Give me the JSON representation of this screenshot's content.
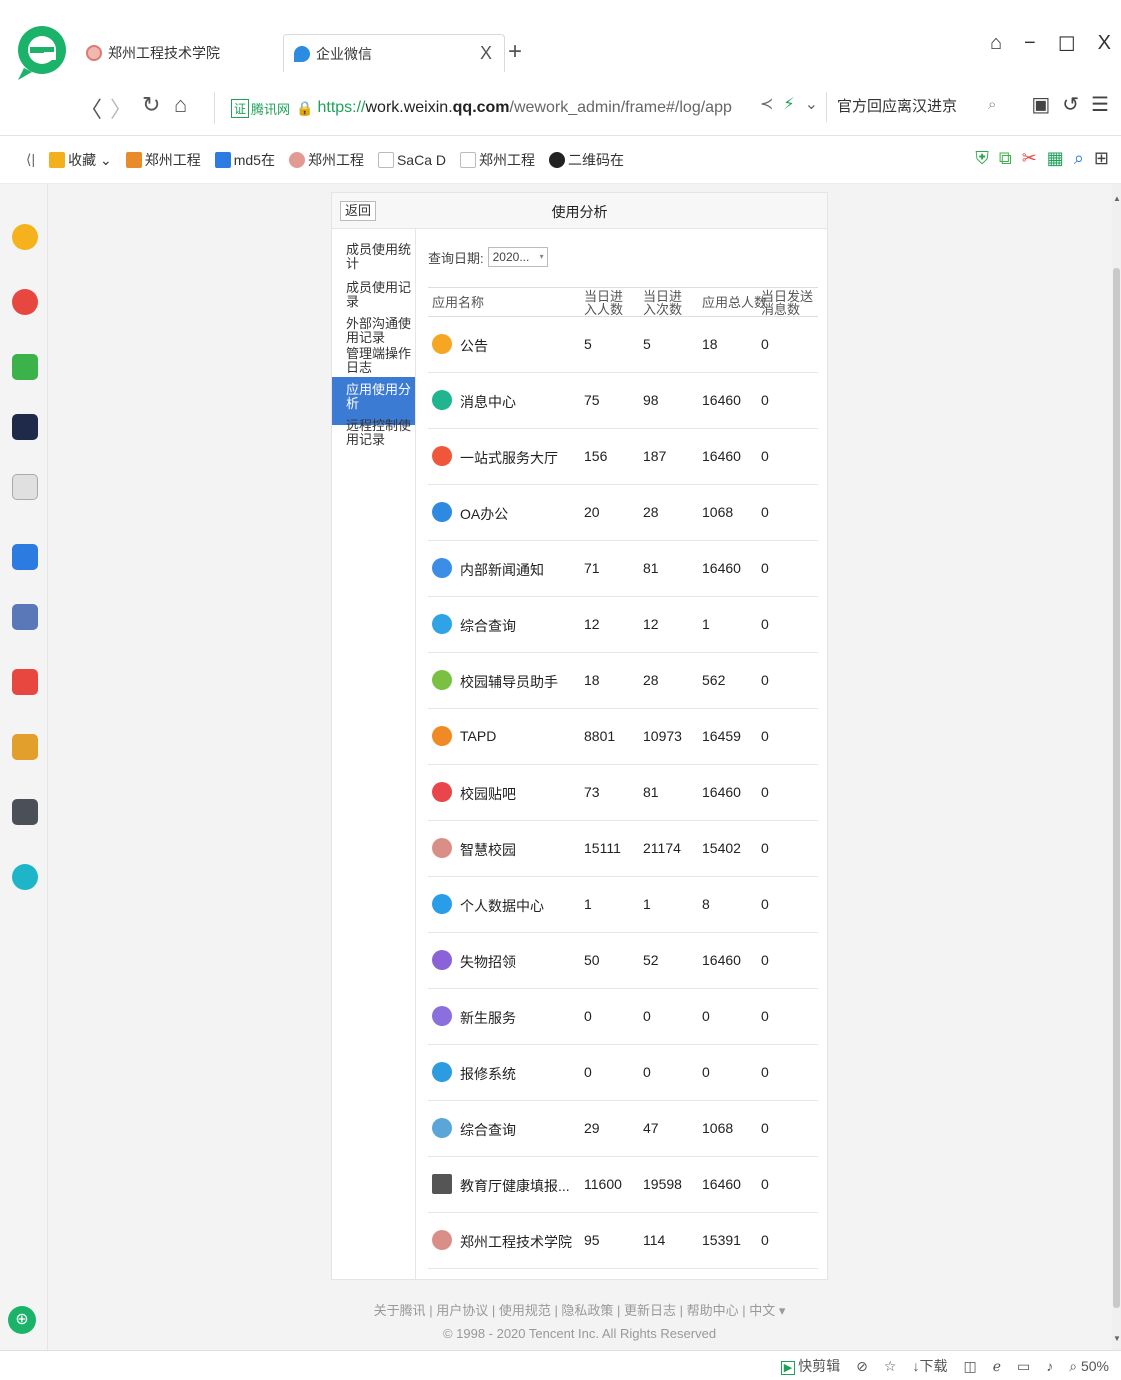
{
  "browser": {
    "tabs": [
      {
        "label": "郑州工程技术学院",
        "icon": "college-seal-icon"
      },
      {
        "label": "企业微信",
        "icon": "wework-icon",
        "active": true
      }
    ],
    "new_tab": "+",
    "tab_close": "X",
    "window_controls": {
      "skin": "skin-icon",
      "minimize": "−",
      "maximize": "☐",
      "close": "X"
    }
  },
  "addressbar": {
    "cert_badge": "证",
    "cert_label": "腾讯网",
    "url_scheme": "https://",
    "url_host_prefix": "work.weixin.",
    "url_host_bold": "qq.com",
    "url_path": "/wework_admin/frame#/log/app",
    "search_text": "官方回应离汉进京"
  },
  "bookmarks": {
    "toggle": "⟨|",
    "items": [
      {
        "label": "收藏 ⌄",
        "icon": "star-folder-icon",
        "color": "#f2b01e"
      },
      {
        "label": "郑州工程",
        "icon": "college-icon",
        "color": "#e98a2b"
      },
      {
        "label": "md5在",
        "icon": "md5-icon",
        "color": "#2b7be0"
      },
      {
        "label": "郑州工程",
        "icon": "seal-icon",
        "color": "#e29a93"
      },
      {
        "label": "SaCa D",
        "icon": "page-icon",
        "color": "#bbbbbb"
      },
      {
        "label": "郑州工程",
        "icon": "page-icon",
        "color": "#bbbbbb"
      },
      {
        "label": "二维码在",
        "icon": "qr-icon",
        "color": "#222222"
      }
    ]
  },
  "panel": {
    "back_label": "返回",
    "title": "使用分析",
    "menu": [
      {
        "label": "成员使用统计",
        "active": false
      },
      {
        "label": "成员使用记录",
        "active": false
      },
      {
        "label": "外部沟通使用记录",
        "active": false
      },
      {
        "label": "管理端操作日志",
        "active": false
      },
      {
        "label": "应用使用分析",
        "active": true
      },
      {
        "label": "远程控制使用记录",
        "active": false
      }
    ],
    "query_label": "查询日期:",
    "query_value": "2020...",
    "columns": [
      "应用名称",
      "当日进入人数",
      "当日进入次数",
      "应用总人数",
      "当日发送消息数"
    ],
    "rows": [
      {
        "name": "公告",
        "icon": "announcement-icon",
        "color": "#f5a623",
        "a": "5",
        "b": "5",
        "c": "18",
        "d": "0"
      },
      {
        "name": "消息中心",
        "icon": "message-center-icon",
        "color": "#1fb58f",
        "a": "75",
        "b": "98",
        "c": "16460",
        "d": "0"
      },
      {
        "name": "一站式服务大厅",
        "icon": "service-hall-icon",
        "color": "#f0573a",
        "a": "156",
        "b": "187",
        "c": "16460",
        "d": "0"
      },
      {
        "name": "OA办公",
        "icon": "oa-icon",
        "color": "#2d8ae0",
        "a": "20",
        "b": "28",
        "c": "1068",
        "d": "0"
      },
      {
        "name": "内部新闻通知",
        "icon": "news-icon",
        "color": "#3b8de6",
        "a": "71",
        "b": "81",
        "c": "16460",
        "d": "0"
      },
      {
        "name": "综合查询",
        "icon": "query-icon",
        "color": "#2fa3e6",
        "a": "12",
        "b": "12",
        "c": "1",
        "d": "0"
      },
      {
        "name": "校园辅导员助手",
        "icon": "counselor-icon",
        "color": "#7ac143",
        "a": "18",
        "b": "28",
        "c": "562",
        "d": "0"
      },
      {
        "name": "TAPD",
        "icon": "tapd-icon",
        "color": "#f08a24",
        "a": "8801",
        "b": "10973",
        "c": "16459",
        "d": "0"
      },
      {
        "name": "校园贴吧",
        "icon": "tieba-icon",
        "color": "#e8464b",
        "a": "73",
        "b": "81",
        "c": "16460",
        "d": "0"
      },
      {
        "name": "智慧校园",
        "icon": "smart-campus-seal-icon",
        "color": "#d98f88",
        "a": "15111",
        "b": "21174",
        "c": "15402",
        "d": "0"
      },
      {
        "name": "个人数据中心",
        "icon": "personal-data-icon",
        "color": "#2a9de8",
        "a": "1",
        "b": "1",
        "c": "8",
        "d": "0"
      },
      {
        "name": "失物招领",
        "icon": "lost-found-icon",
        "color": "#8b63d8",
        "a": "50",
        "b": "52",
        "c": "16460",
        "d": "0"
      },
      {
        "name": "新生服务",
        "icon": "freshman-icon",
        "color": "#8b6fdc",
        "a": "0",
        "b": "0",
        "c": "0",
        "d": "0"
      },
      {
        "name": "报修系统",
        "icon": "repair-icon",
        "color": "#2d9be0",
        "a": "0",
        "b": "0",
        "c": "0",
        "d": "0"
      },
      {
        "name": "综合查询",
        "icon": "integrated-query-icon",
        "color": "#5aa6d8",
        "a": "29",
        "b": "47",
        "c": "1068",
        "d": "0"
      },
      {
        "name": "教育厅健康填报...",
        "icon": "qr-code-icon",
        "color": "#555555",
        "a": "11600",
        "b": "19598",
        "c": "16460",
        "d": "0"
      },
      {
        "name": "郑州工程技术学院",
        "icon": "college-seal-icon",
        "color": "#d98f88",
        "a": "95",
        "b": "114",
        "c": "15391",
        "d": "0"
      }
    ]
  },
  "footer": {
    "links": "关于腾讯 | 用户协议 | 使用规范 | 隐私政策 | 更新日志 | 帮助中心 | 中文 ▾",
    "copyright": "© 1998 - 2020 Tencent Inc. All Rights Reserved"
  },
  "statusbar": {
    "fast_clip": "快剪辑",
    "download": "下载",
    "zoom": "50%"
  }
}
